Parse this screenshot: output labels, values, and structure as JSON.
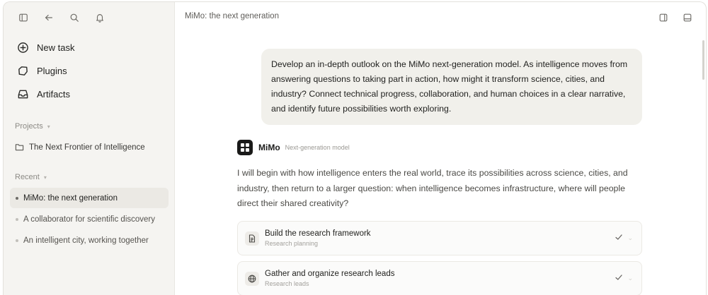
{
  "sidebar": {
    "top_icons": [
      "sidebar-toggle-icon",
      "back-arrow-icon",
      "search-icon",
      "bell-icon"
    ],
    "nav": [
      {
        "label": "New task",
        "icon": "plus-circle-icon"
      },
      {
        "label": "Plugins",
        "icon": "plugin-icon"
      },
      {
        "label": "Artifacts",
        "icon": "inbox-icon"
      }
    ],
    "projects_label": "Projects",
    "projects": [
      {
        "label": "The Next Frontier of Intelligence",
        "icon": "folder-icon"
      }
    ],
    "recent_label": "Recent",
    "recent": [
      {
        "label": "MiMo: the next generation",
        "active": true
      },
      {
        "label": "A collaborator for scientific discovery",
        "active": false
      },
      {
        "label": "An intelligent city, working together",
        "active": false
      }
    ]
  },
  "header": {
    "title": "MiMo: the next generation",
    "right_icons": [
      "split-panel-icon",
      "bottom-panel-icon"
    ]
  },
  "conversation": {
    "user_message": "Develop an in-depth outlook on the MiMo next-generation model. As intelligence moves from answering questions to taking part in action, how might it transform science, cities, and industry? Connect technical progress, collaboration, and human choices in a clear narrative, and identify future possibilities worth exploring.",
    "assistant": {
      "name": "MiMo",
      "subtitle": "Next-generation model",
      "reply": "I will begin with how intelligence enters the real world, trace its possibilities across science, cities, and industry, then return to a larger question: when intelligence becomes infrastructure, where will people direct their shared creativity?"
    },
    "steps": [
      {
        "title": "Build the research framework",
        "subtitle": "Research planning",
        "icon": "document-icon",
        "status": "done"
      },
      {
        "title": "Gather and organize research leads",
        "subtitle": "Research leads",
        "icon": "globe-icon",
        "status": "done"
      }
    ]
  }
}
